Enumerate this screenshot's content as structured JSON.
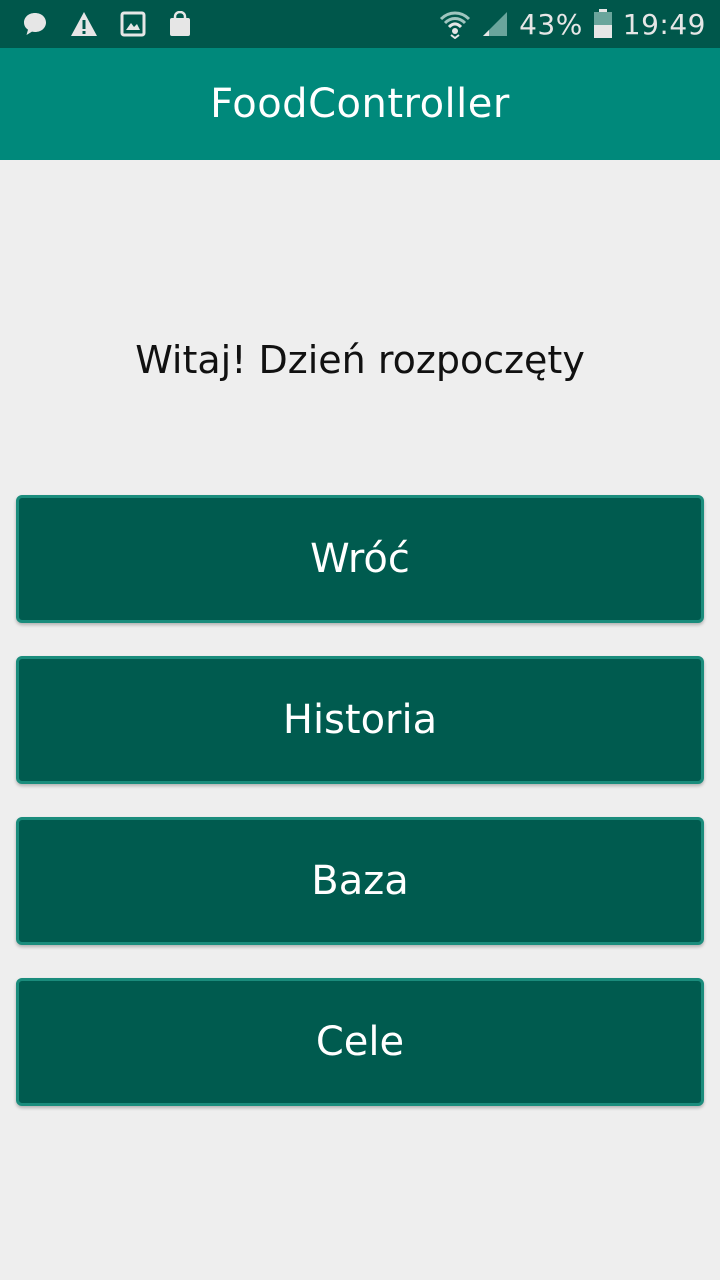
{
  "status_bar": {
    "left_icons": [
      "chat-bubble-icon",
      "warning-icon",
      "image-icon",
      "shopping-bag-icon"
    ],
    "right_icons": [
      "wifi-icon",
      "signal-icon",
      "battery-icon"
    ],
    "battery_percent": "43%",
    "time": "19:49"
  },
  "app_bar": {
    "title": "FoodController"
  },
  "main": {
    "greeting": "Witaj! Dzień rozpoczęty",
    "buttons": [
      {
        "label": "Wróć"
      },
      {
        "label": "Historia"
      },
      {
        "label": "Baza"
      },
      {
        "label": "Cele"
      }
    ]
  },
  "colors": {
    "status_bar": "#00574b",
    "app_bar": "#00897b",
    "button_bg": "#005b4f",
    "button_border": "#1a8c7c",
    "background": "#eeeeee"
  }
}
